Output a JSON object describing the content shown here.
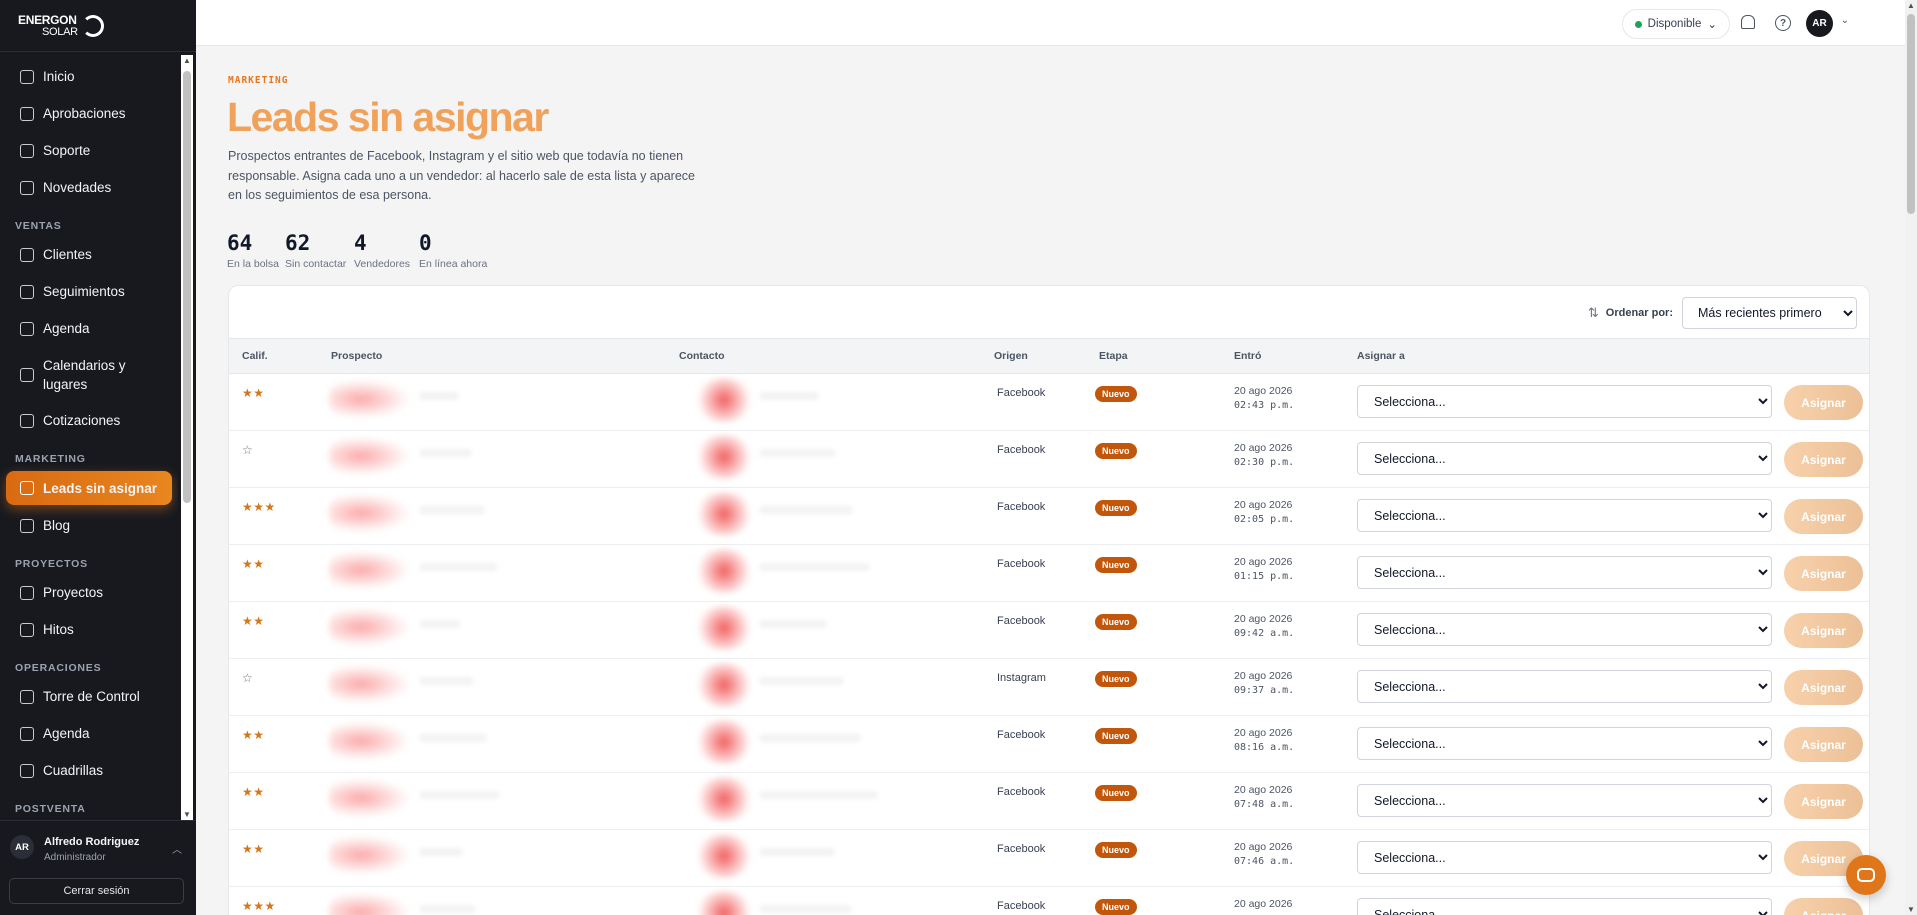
{
  "brand": {
    "line1": "ENERGON",
    "line2": "SOLAR"
  },
  "sidebar": {
    "groups": [
      {
        "section": "",
        "items": [
          {
            "label": "Inicio",
            "icon": "home-icon"
          },
          {
            "label": "Aprobaciones",
            "icon": "clipboard-check-icon"
          },
          {
            "label": "Soporte",
            "icon": "lifebuoy-icon"
          },
          {
            "label": "Novedades",
            "icon": "megaphone-icon"
          }
        ]
      },
      {
        "section": "VENTAS",
        "items": [
          {
            "label": "Clientes",
            "icon": "id-card-icon"
          },
          {
            "label": "Seguimientos",
            "icon": "calendar-icon"
          },
          {
            "label": "Agenda",
            "icon": "calendar-clock-icon"
          },
          {
            "label": "Calendarios y lugares",
            "icon": "calendar-cog-icon",
            "tall": true
          },
          {
            "label": "Cotizaciones",
            "icon": "document-icon"
          }
        ]
      },
      {
        "section": "MARKETING",
        "items": [
          {
            "label": "Leads sin asignar",
            "icon": "inbox-icon",
            "active": true
          },
          {
            "label": "Blog",
            "icon": "newspaper-icon"
          }
        ]
      },
      {
        "section": "PROYECTOS",
        "items": [
          {
            "label": "Proyectos",
            "icon": "folder-icon"
          },
          {
            "label": "Hitos",
            "icon": "milestone-icon"
          }
        ]
      },
      {
        "section": "OPERACIONES",
        "items": [
          {
            "label": "Torre de Control",
            "icon": "tower-icon"
          },
          {
            "label": "Agenda",
            "icon": "calendar-icon"
          },
          {
            "label": "Cuadrillas",
            "icon": "hard-hat-icon"
          }
        ]
      },
      {
        "section": "POSTVENTA",
        "items": []
      }
    ],
    "user": {
      "initials": "AR",
      "name": "Alfredo Rodriguez",
      "role": "Administrador"
    },
    "logout_label": "Cerrar sesión"
  },
  "topbar": {
    "status": "Disponible",
    "status_color": "#22a05b",
    "avatar_initials": "AR"
  },
  "page": {
    "eyebrow": "MARKETING",
    "title": "Leads sin asignar",
    "description": "Prospectos entrantes de Facebook, Instagram y el sitio web que todavía no tienen responsable. Asigna cada uno a un vendedor: al hacerlo sale de esta lista y aparece en los seguimientos de esa persona.",
    "stats": [
      {
        "value": "64",
        "label": "En la bolsa"
      },
      {
        "value": "62",
        "label": "Sin contactar"
      },
      {
        "value": "4",
        "label": "Vendedores"
      },
      {
        "value": "0",
        "label": "En línea ahora"
      }
    ]
  },
  "table": {
    "sort_label": "Ordenar por:",
    "sort_value": "Más recientes primero",
    "columns": [
      "Calif.",
      "Prospecto",
      "Contacto",
      "Origen",
      "Etapa",
      "Entró",
      "Asignar a"
    ],
    "select_placeholder": "Selecciona...",
    "assign_label": "Asignar",
    "rows": [
      {
        "rating": 2,
        "origin": "Facebook",
        "stage": "Nuevo",
        "date": "20 ago 2026",
        "time": "02:43 p.m."
      },
      {
        "rating": 0,
        "origin": "Facebook",
        "stage": "Nuevo",
        "date": "20 ago 2026",
        "time": "02:30 p.m."
      },
      {
        "rating": 3,
        "origin": "Facebook",
        "stage": "Nuevo",
        "date": "20 ago 2026",
        "time": "02:05 p.m."
      },
      {
        "rating": 2,
        "origin": "Facebook",
        "stage": "Nuevo",
        "date": "20 ago 2026",
        "time": "01:15 p.m."
      },
      {
        "rating": 2,
        "origin": "Facebook",
        "stage": "Nuevo",
        "date": "20 ago 2026",
        "time": "09:42 a.m."
      },
      {
        "rating": 0,
        "origin": "Instagram",
        "stage": "Nuevo",
        "date": "20 ago 2026",
        "time": "09:37 a.m."
      },
      {
        "rating": 2,
        "origin": "Facebook",
        "stage": "Nuevo",
        "date": "20 ago 2026",
        "time": "08:16 a.m."
      },
      {
        "rating": 2,
        "origin": "Facebook",
        "stage": "Nuevo",
        "date": "20 ago 2026",
        "time": "07:48 a.m."
      },
      {
        "rating": 2,
        "origin": "Facebook",
        "stage": "Nuevo",
        "date": "20 ago 2026",
        "time": "07:46 a.m."
      },
      {
        "rating": 3,
        "origin": "Facebook",
        "stage": "Nuevo",
        "date": "20 ago 2026",
        "time": ""
      }
    ]
  },
  "colors": {
    "accent": "#e8761e",
    "title": "#f0a25a",
    "badge": "#c2570c",
    "sidebar_bg": "#17191f"
  }
}
